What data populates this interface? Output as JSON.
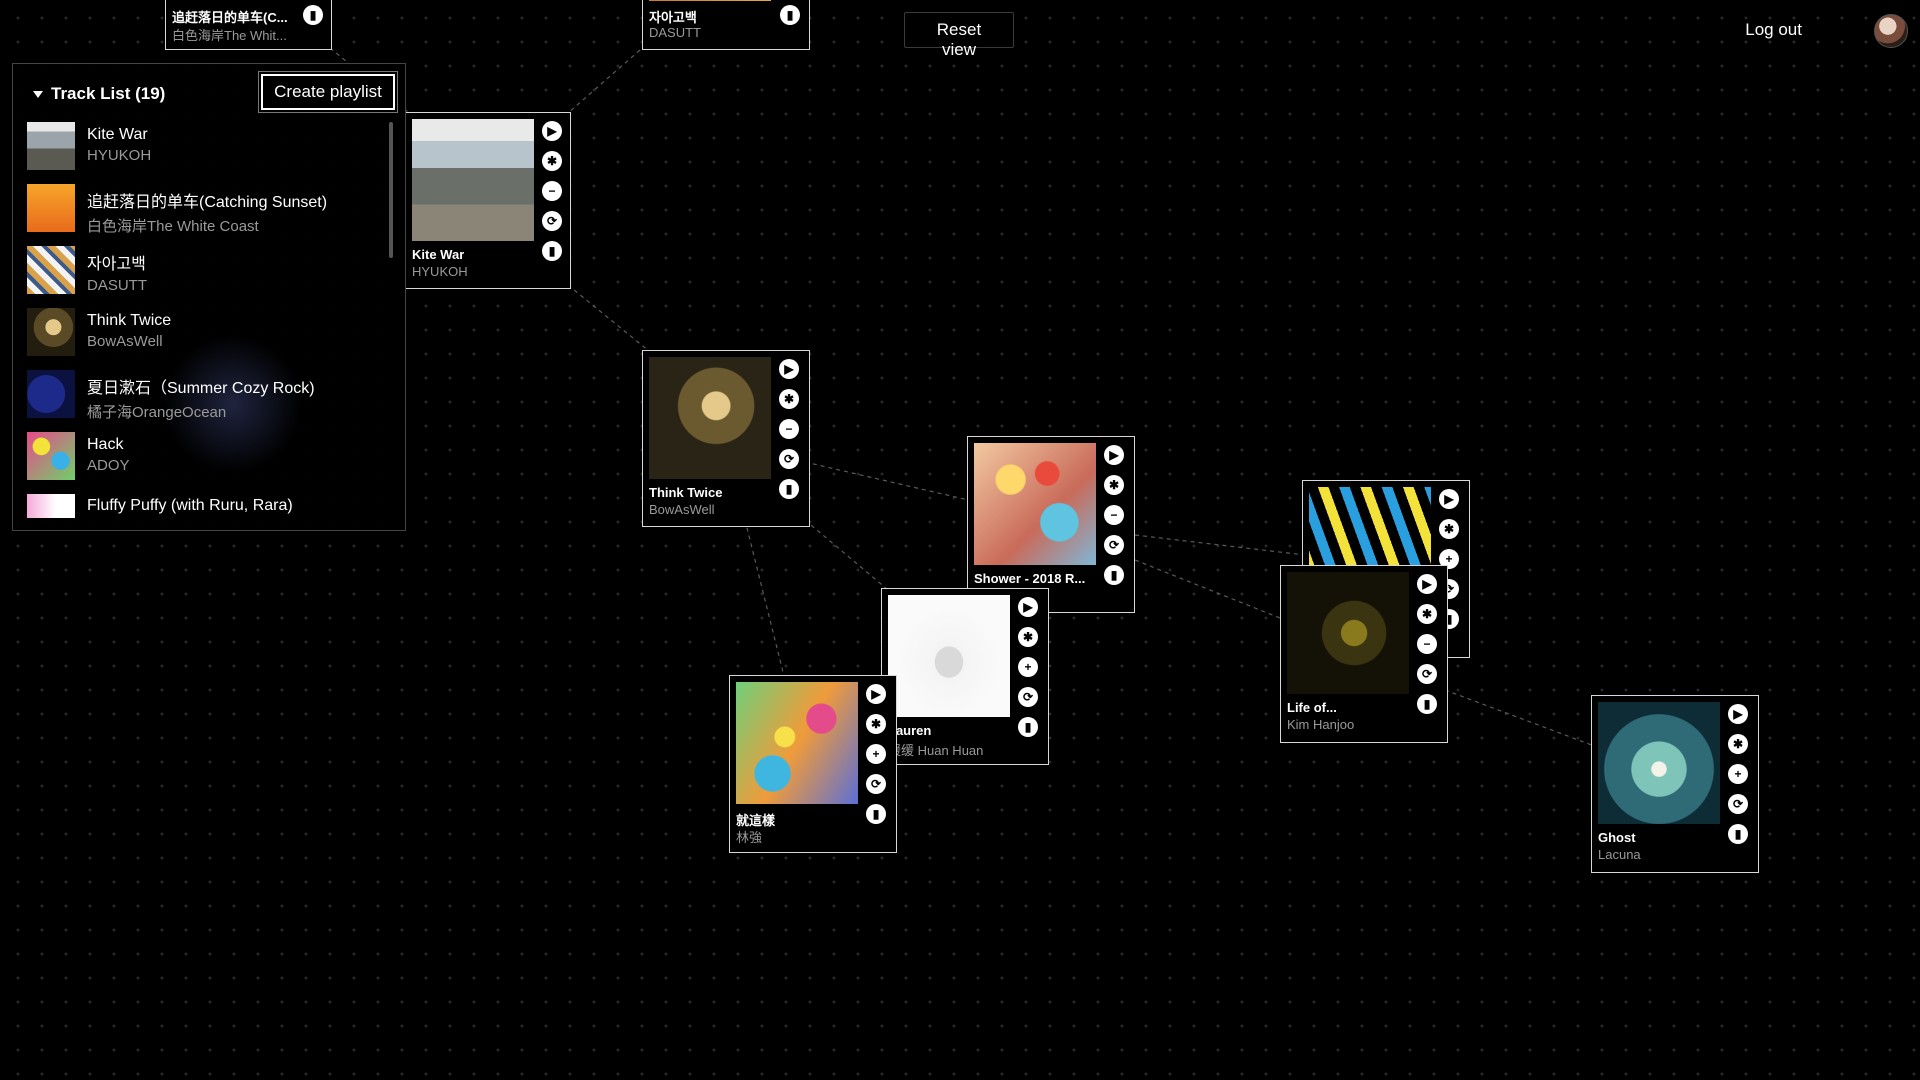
{
  "header": {
    "reset_label": "Reset view",
    "logout_label": "Log out"
  },
  "track_list": {
    "title": "Track List (19)",
    "create_label": "Create playlist",
    "items": [
      {
        "title": "Kite War",
        "artist": "HYUKOH"
      },
      {
        "title": "追赶落日的单车(Catching Sunset)",
        "artist": "白色海岸The White Coast"
      },
      {
        "title": "자아고백",
        "artist": "DASUTT"
      },
      {
        "title": "Think Twice",
        "artist": "BowAsWell"
      },
      {
        "title": "夏日漱石（Summer Cozy Rock)",
        "artist": "橘子海OrangeOcean"
      },
      {
        "title": "Hack",
        "artist": "ADOY"
      },
      {
        "title": "Fluffy Puffy (with Ruru, Rara)",
        "artist": ""
      }
    ]
  },
  "graph": {
    "cards": [
      {
        "title": "追赶落日的单车(C...",
        "artist": "白色海岸The Whit..."
      },
      {
        "title": "자아고백",
        "artist": "DASUTT"
      },
      {
        "title": "Kite War",
        "artist": "HYUKOH"
      },
      {
        "title": "Think Twice",
        "artist": "BowAsWell"
      },
      {
        "title": "Shower - 2018 R...",
        "artist": ""
      },
      {
        "title": "Lauren",
        "artist": "缓缓 Huan Huan"
      },
      {
        "title": "就這樣",
        "artist": "林強"
      },
      {
        "title": "Life of...",
        "artist": "Kim Hanjoo"
      },
      {
        "title": "Ghost",
        "artist": "Lacuna"
      }
    ],
    "controls": {
      "play": "▶",
      "star": "✱",
      "minus": "−",
      "plus": "+",
      "refresh": "⟳",
      "delete": "▮"
    }
  }
}
